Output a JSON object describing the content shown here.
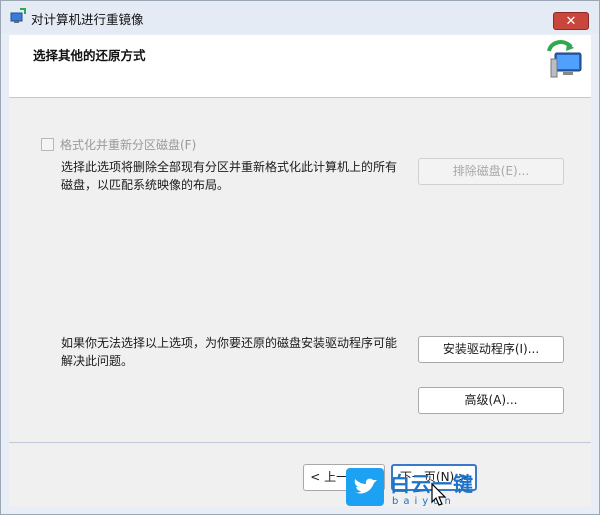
{
  "window": {
    "title": "对计算机进行重镜像",
    "close_label": "✕"
  },
  "header": {
    "title": "选择其他的还原方式"
  },
  "format_option": {
    "checkbox_label": "格式化并重新分区磁盘(F)",
    "checked": false,
    "description_line1": "选择此选项将删除全部现有分区并重新格式化此计算机上的所有",
    "description_line2": "磁盘，以匹配系统映像的布局。",
    "exclude_button": "排除磁盘(E)..."
  },
  "driver_option": {
    "description_line1": "如果你无法选择以上选项，为你要还原的磁盘安装驱动程序可能",
    "description_line2": "解决此问题。",
    "install_button": "安装驱动程序(I)...",
    "advanced_button": "高级(A)..."
  },
  "footer": {
    "back_button": "< 上一步(B)",
    "next_button": "下一页(N) >"
  },
  "watermark": {
    "text": "白云一键",
    "sub": "baiyun"
  }
}
